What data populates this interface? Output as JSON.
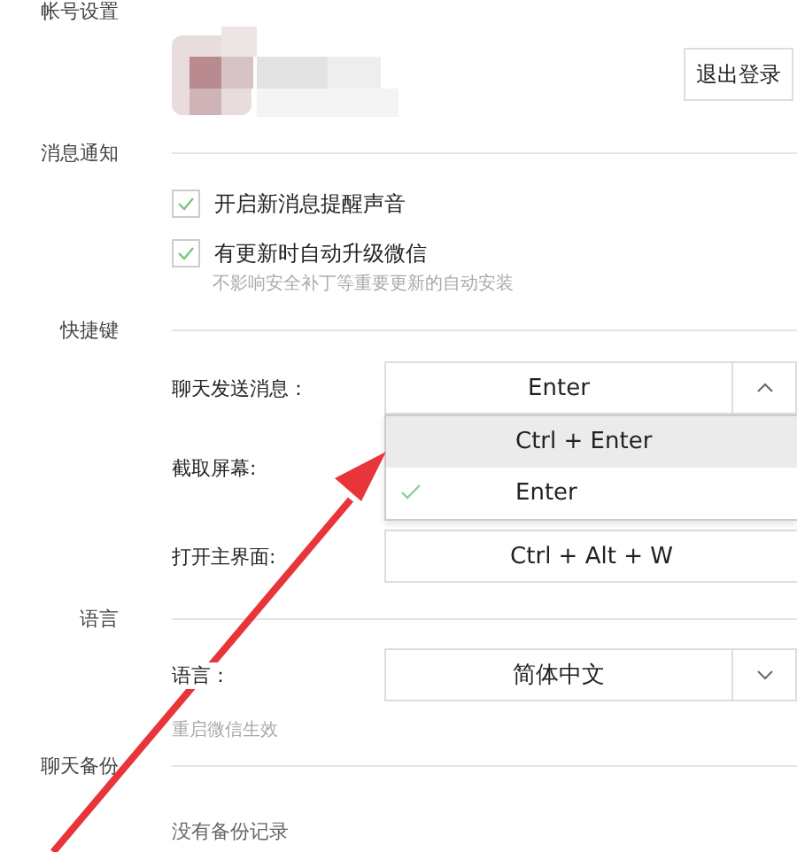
{
  "account": {
    "title": "帐号设置",
    "logout_button": "退出登录"
  },
  "notifications": {
    "title": "消息通知",
    "options": [
      {
        "label": "开启新消息提醒声音",
        "checked": true
      },
      {
        "label": "有更新时自动升级微信",
        "checked": true,
        "hint": "不影响安全补丁等重要更新的自动安装"
      }
    ]
  },
  "shortcuts": {
    "title": "快捷键",
    "rows": [
      {
        "label": "聊天发送消息：",
        "value": "Enter",
        "expanded": true,
        "menu": [
          {
            "label": "Ctrl + Enter",
            "selected": false,
            "highlighted": true
          },
          {
            "label": "Enter",
            "selected": true,
            "highlighted": false
          }
        ]
      },
      {
        "label": "截取屏幕:"
      },
      {
        "label": "打开主界面:",
        "value": "Ctrl + Alt + W"
      }
    ]
  },
  "language": {
    "title": "语言",
    "label": "语言：",
    "value": "简体中文",
    "hint": "重启微信生效"
  },
  "backup": {
    "title": "聊天备份",
    "status": "没有备份记录"
  }
}
